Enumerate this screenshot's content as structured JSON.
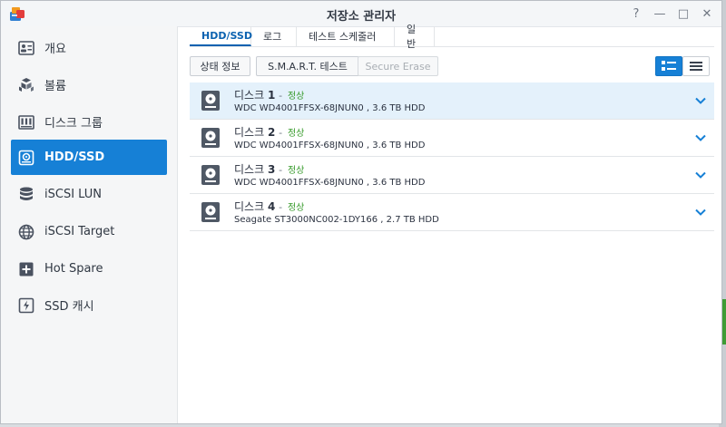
{
  "window": {
    "title": "저장소 관리자",
    "buttons": [
      "?",
      "—",
      "□",
      "✕"
    ]
  },
  "sidebar": {
    "items": [
      {
        "label": "개요",
        "icon": "overview-icon"
      },
      {
        "label": "볼륨",
        "icon": "volume-icon"
      },
      {
        "label": "디스크 그룹",
        "icon": "disk-group-icon"
      },
      {
        "label": "HDD/SSD",
        "icon": "hdd-icon",
        "active": true
      },
      {
        "label": "iSCSI LUN",
        "icon": "database-icon"
      },
      {
        "label": "iSCSI Target",
        "icon": "globe-icon"
      },
      {
        "label": "Hot Spare",
        "icon": "hot-spare-icon"
      },
      {
        "label": "SSD 캐시",
        "icon": "ssd-cache-icon"
      }
    ]
  },
  "tabs": [
    {
      "label": "HDD/SSD",
      "active": true
    },
    {
      "label": "로그"
    },
    {
      "label": "테스트 스케줄러"
    },
    {
      "label": "일반"
    }
  ],
  "toolbar": {
    "status_label": "상태 정보",
    "smart_label": "S.M.A.R.T. 테스트",
    "erase_label": "Secure Erase"
  },
  "disks": [
    {
      "name": "디스크",
      "number": "1",
      "separator": "-",
      "status": "정상",
      "model": "WDC WD4001FFSX-68JNUN0 , 3.6 TB HDD"
    },
    {
      "name": "디스크",
      "number": "2",
      "separator": "-",
      "status": "정상",
      "model": "WDC WD4001FFSX-68JNUN0 , 3.6 TB HDD"
    },
    {
      "name": "디스크",
      "number": "3",
      "separator": "-",
      "status": "정상",
      "model": "WDC WD4001FFSX-68JNUN0 , 3.6 TB HDD"
    },
    {
      "name": "디스크",
      "number": "4",
      "separator": "-",
      "status": "정상",
      "model": "Seagate ST3000NC002-1DY166 , 2.7 TB HDD"
    }
  ],
  "colors": {
    "accent": "#1680d6",
    "status_ok": "#3a9c2e",
    "selected_row": "#e4f1fb"
  }
}
